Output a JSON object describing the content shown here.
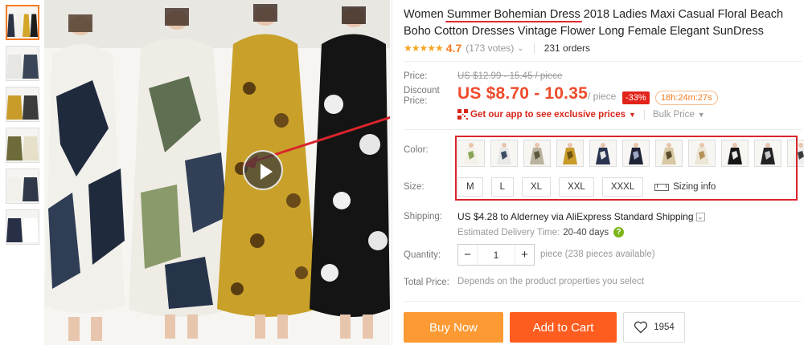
{
  "gallery": {
    "thumbnails": [
      {
        "name": "thumb-1",
        "active": true,
        "palette": [
          "#2c3444",
          "#f2f0ea",
          "#d4a528",
          "#1c1c1c"
        ]
      },
      {
        "name": "thumb-2",
        "active": false,
        "palette": [
          "#e6e6e2",
          "#3a4657"
        ]
      },
      {
        "name": "thumb-3",
        "active": false,
        "palette": [
          "#c99c2a",
          "#3b3b3b"
        ]
      },
      {
        "name": "thumb-4",
        "active": false,
        "palette": [
          "#6d6b3a",
          "#e6e0c8"
        ]
      },
      {
        "name": "thumb-5",
        "active": false,
        "palette": [
          "#f2f0ea",
          "#2f3848"
        ]
      },
      {
        "name": "thumb-6",
        "active": false,
        "palette": [
          "#273046",
          "#ffffff"
        ]
      }
    ],
    "main_image_description_icon": "video-play-icon",
    "colors": {
      "dress1": "#1f2a3d",
      "dress2": "#5f6f52",
      "dress3": "#c9a12a",
      "dress4": "#141414"
    }
  },
  "product": {
    "title_before": "Women ",
    "title_highlight": "Summer Bohemian Dress",
    "title_after": " 2018 Ladies Maxi Casual Floral Beach Boho Cotton Dresses Vintage Flower Long Female Elegant SunDress",
    "stars": "★★★★★",
    "rating": "4.7",
    "votes": "(173 votes)",
    "orders": "231 orders"
  },
  "price": {
    "label": "Price:",
    "original": "US $12.99 - 15.45 / piece",
    "discount_label": "Discount Price:",
    "discount": "US $8.70 - 10.35",
    "per_piece": "/ piece",
    "discount_percent": "-33%",
    "countdown": "18h:24m:27s",
    "app_offer": "Get our app to see exclusive prices",
    "bulk_price": "Bulk Price"
  },
  "options": {
    "color_label": "Color:",
    "color_swatches": [
      {
        "name": "swatch-1",
        "colors": [
          "#f4f2e8",
          "#8aa55a"
        ]
      },
      {
        "name": "swatch-2",
        "colors": [
          "#e8e8e6",
          "#3d4c60"
        ]
      },
      {
        "name": "swatch-3",
        "colors": [
          "#b9b3a0",
          "#5d5a3c"
        ]
      },
      {
        "name": "swatch-4",
        "colors": [
          "#c99c2a",
          "#6f5410"
        ]
      },
      {
        "name": "swatch-5",
        "colors": [
          "#2a3550",
          "#e6e6e6"
        ]
      },
      {
        "name": "swatch-6",
        "colors": [
          "#1d2236",
          "#9ba6c3"
        ]
      },
      {
        "name": "swatch-7",
        "colors": [
          "#d8c9a4",
          "#5a4c2c"
        ]
      },
      {
        "name": "swatch-8",
        "colors": [
          "#ece6d6",
          "#b3915a"
        ]
      },
      {
        "name": "swatch-9",
        "colors": [
          "#161616",
          "#e8e8e8"
        ]
      },
      {
        "name": "swatch-10",
        "colors": [
          "#222222",
          "#c7c7c7"
        ]
      },
      {
        "name": "swatch-11",
        "colors": [
          "#eeeeee",
          "#3c3c3c"
        ]
      }
    ],
    "size_label": "Size:",
    "sizes": [
      "M",
      "L",
      "XL",
      "XXL",
      "XXXL"
    ],
    "sizing_info": "Sizing info"
  },
  "shipping": {
    "label": "Shipping:",
    "text": "US $4.28 to Alderney via AliExpress Standard Shipping",
    "delivery_label": "Estimated Delivery Time:",
    "delivery_days": "20-40 days",
    "help": "?"
  },
  "quantity": {
    "label": "Quantity:",
    "value": "1",
    "minus": "−",
    "plus": "+",
    "available": "piece (238 pieces available)"
  },
  "total": {
    "label": "Total Price:",
    "note": "Depends on the product properties you select"
  },
  "actions": {
    "buy_now": "Buy Now",
    "add_to_cart": "Add to Cart",
    "wishlist_count": "1954"
  },
  "accent_colors": {
    "annotation_red": "#d9252b",
    "price_red": "#ee4b2b",
    "buy_orange": "#fd9a33",
    "cart_orange": "#ff5d1f"
  }
}
